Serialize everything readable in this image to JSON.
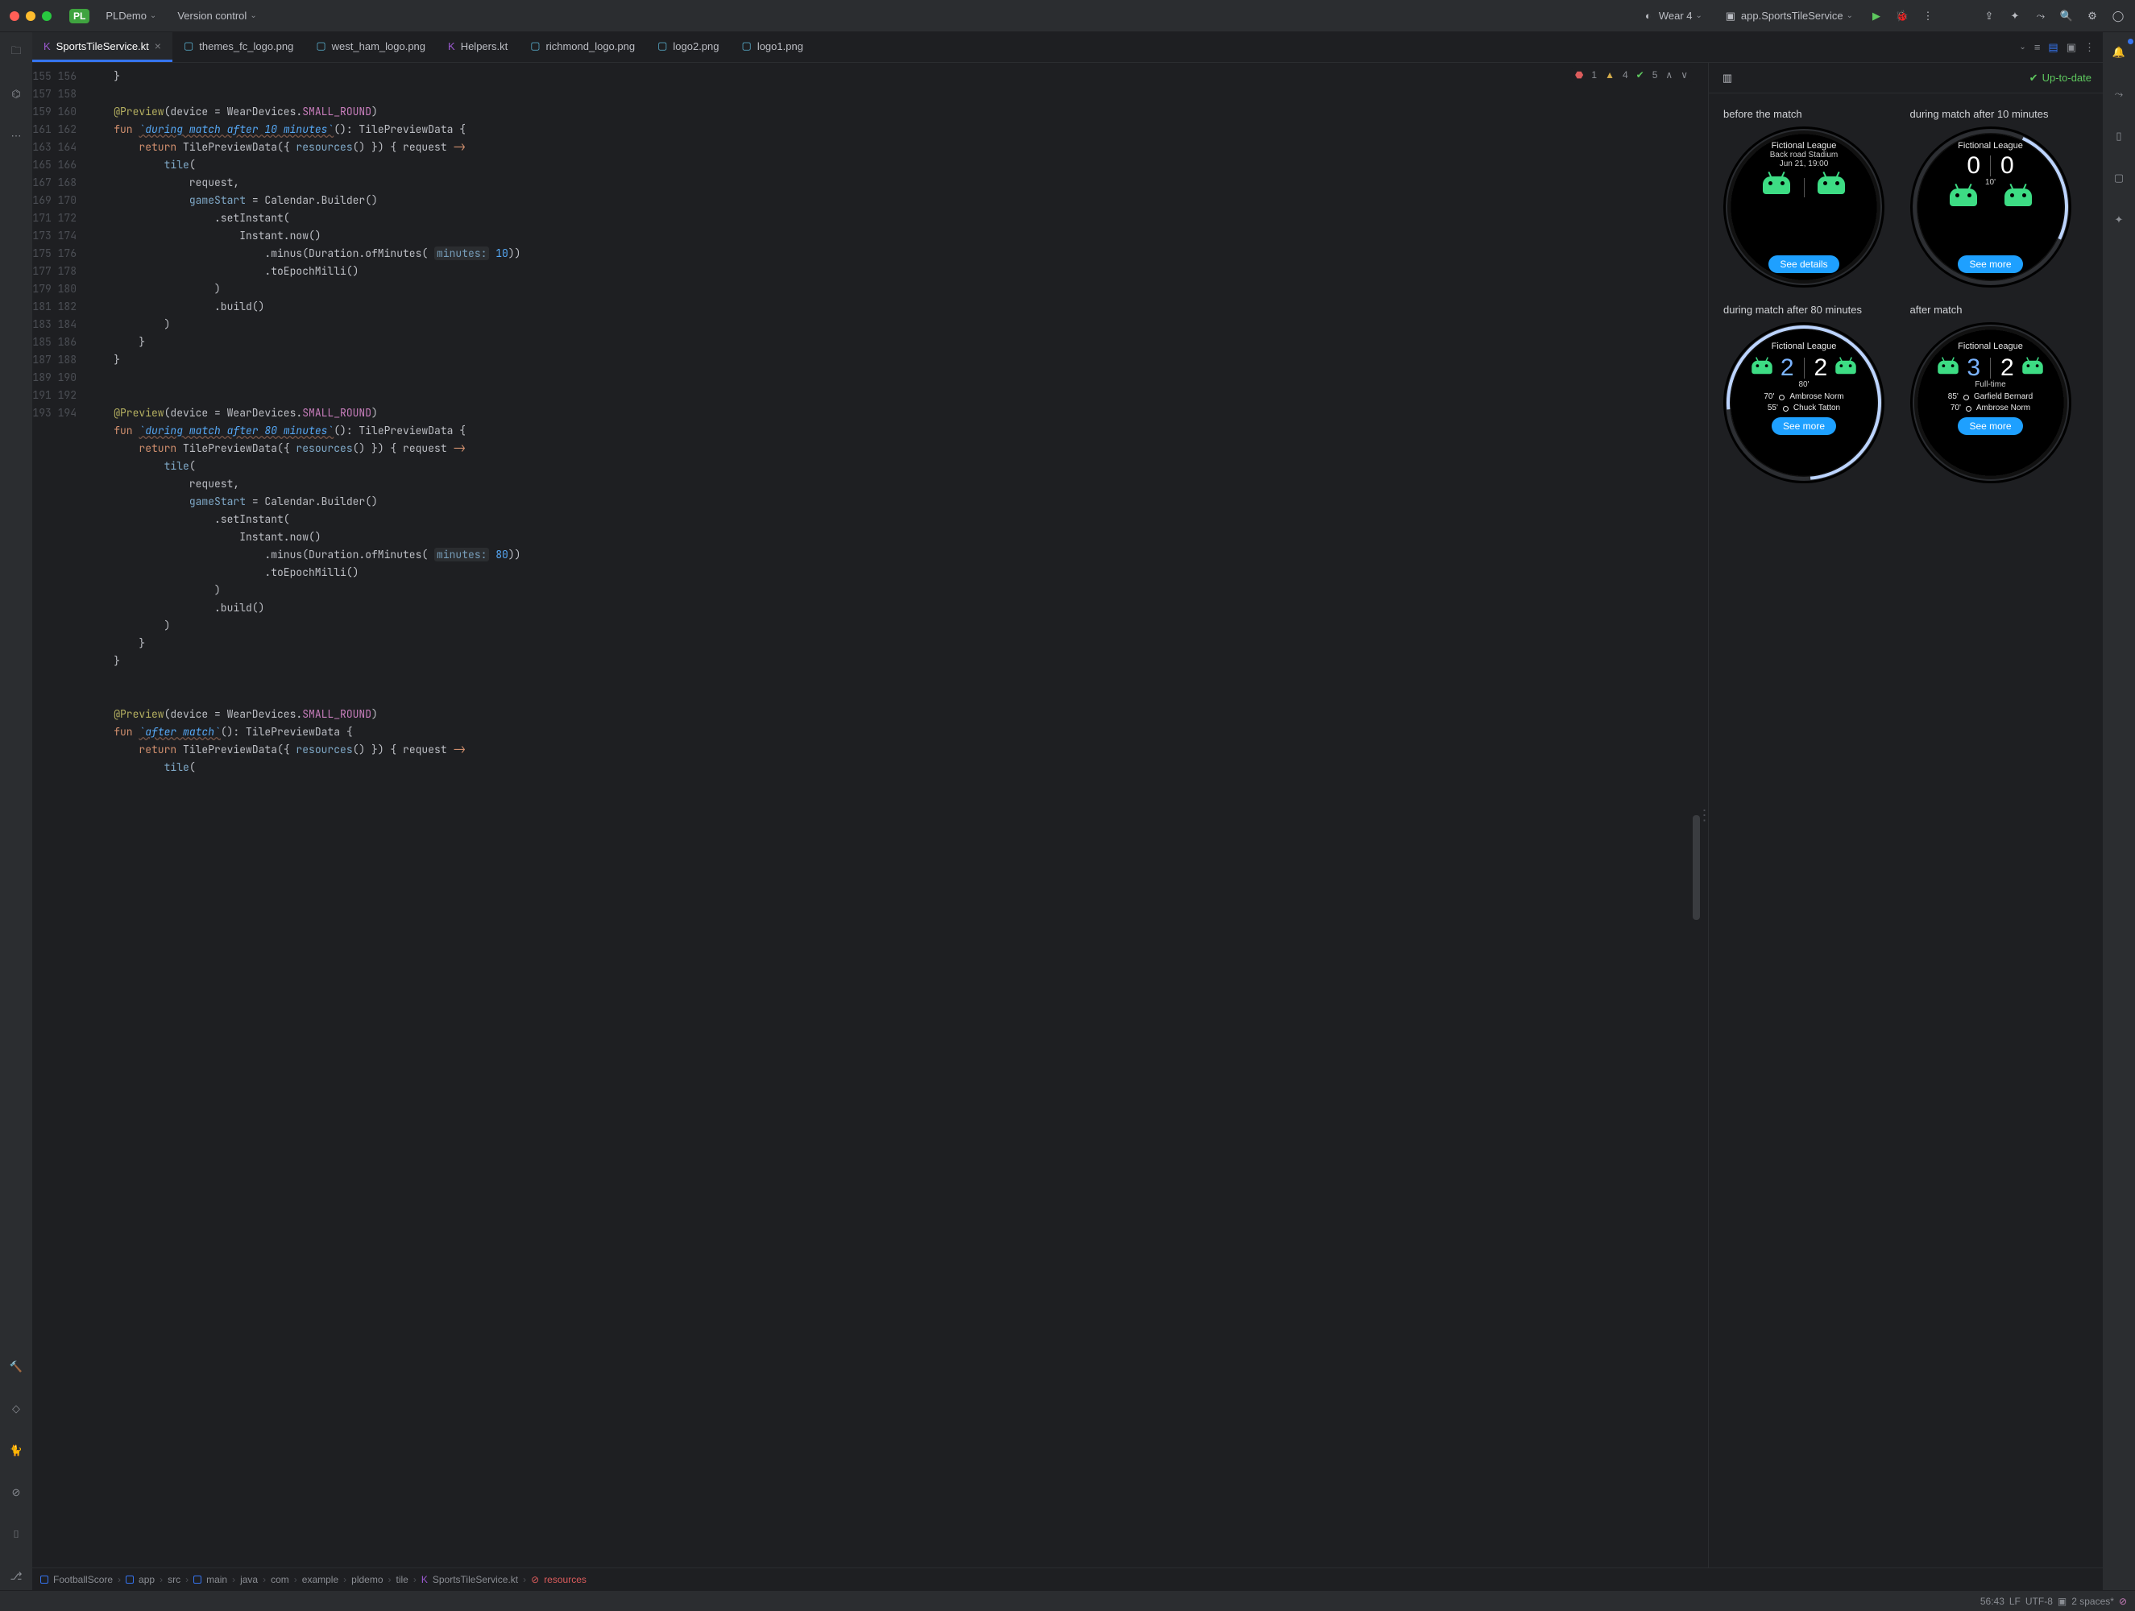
{
  "title": {
    "project": "PLDemo",
    "projectBadge": "PL",
    "vcs": "Version control"
  },
  "runbar": {
    "device": "Wear 4",
    "config": "app.SportsTileService"
  },
  "tabs": [
    {
      "label": "SportsTileService.kt",
      "icon": "kt",
      "active": true,
      "closeable": true
    },
    {
      "label": "themes_fc_logo.png",
      "icon": "img"
    },
    {
      "label": "west_ham_logo.png",
      "icon": "img"
    },
    {
      "label": "Helpers.kt",
      "icon": "kt"
    },
    {
      "label": "richmond_logo.png",
      "icon": "img"
    },
    {
      "label": "logo2.png",
      "icon": "img"
    },
    {
      "label": "logo1.png",
      "icon": "img"
    }
  ],
  "inspections": {
    "errors": "1",
    "warnings": "4",
    "ok": "5"
  },
  "gutter_start": 155,
  "gutter_end": 194,
  "preview": {
    "status": "Up-to-date",
    "w1": {
      "title": "before the match",
      "league": "Fictional League",
      "stadium": "Back road Stadium",
      "date": "Jun 21, 19:00",
      "btn": "See details"
    },
    "w2": {
      "title": "during match after 10 minutes",
      "league": "Fictional League",
      "home": "0",
      "away": "0",
      "minute": "10'",
      "btn": "See more"
    },
    "w3": {
      "title": "during match after 80 minutes",
      "league": "Fictional League",
      "home": "2",
      "away": "2",
      "minute": "80'",
      "btn": "See more",
      "e1t": "70'",
      "e1n": "Ambrose Norm",
      "e2t": "55'",
      "e2n": "Chuck Tatton"
    },
    "w4": {
      "title": "after match",
      "league": "Fictional League",
      "home": "3",
      "away": "2",
      "status": "Full-time",
      "btn": "See more",
      "e1t": "85'",
      "e1n": "Garfield Bernard",
      "e2t": "70'",
      "e2n": "Ambrose Norm"
    }
  },
  "breadcrumbs": [
    "FootballScore",
    "app",
    "src",
    "main",
    "java",
    "com",
    "example",
    "pldemo",
    "tile",
    "SportsTileService.kt",
    "resources"
  ],
  "status": {
    "pos": "56:43",
    "le": "LF",
    "enc": "UTF-8",
    "indent": "2 spaces*"
  }
}
